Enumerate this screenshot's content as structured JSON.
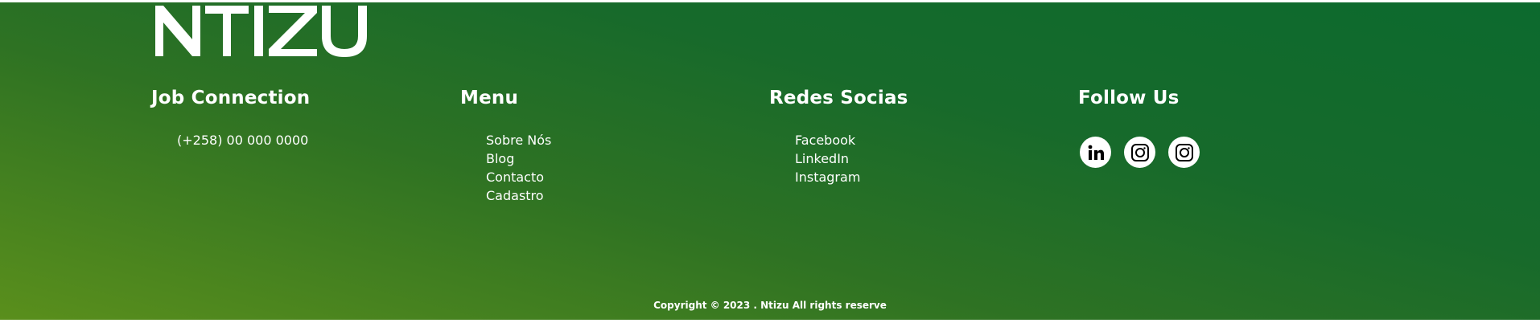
{
  "brand": {
    "logo_text": "NTIZU"
  },
  "columns": {
    "job": {
      "heading": "Job Connection",
      "items": [
        "(+258) 00 000 0000"
      ]
    },
    "menu": {
      "heading": "Menu",
      "items": [
        "Sobre Nós",
        "Blog",
        "Contacto",
        "Cadastro"
      ]
    },
    "redes": {
      "heading": "Redes Socias",
      "items": [
        "Facebook",
        "LinkedIn",
        "Instagram"
      ]
    },
    "follow": {
      "heading": "Follow Us",
      "icons": [
        "linkedin-icon",
        "instagram-icon",
        "instagram-icon"
      ]
    }
  },
  "copyright": "Copyright © 2023 . Ntizu All rights reserve",
  "colors": {
    "gradient_top": "#0c6a2e",
    "gradient_bottom": "#5a8f1c",
    "text": "#ffffff",
    "icon": "#000000"
  }
}
